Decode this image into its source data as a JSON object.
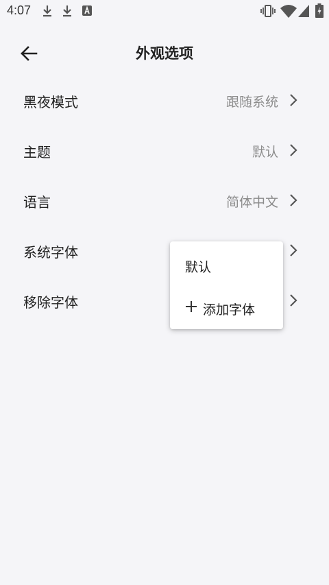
{
  "status_bar": {
    "time": "4:07",
    "icons": [
      "download-icon",
      "download-icon",
      "a-icon",
      "vibrate-icon",
      "wifi-icon",
      "signal-icon",
      "battery-charging-icon"
    ]
  },
  "header": {
    "title": "外观选项",
    "back_icon": "arrow-left-icon"
  },
  "settings": [
    {
      "label": "黑夜模式",
      "value": "跟随系统"
    },
    {
      "label": "主题",
      "value": "默认"
    },
    {
      "label": "语言",
      "value": "简体中文"
    },
    {
      "label": "系统字体",
      "value": ""
    },
    {
      "label": "移除字体",
      "value": ""
    }
  ],
  "popup_menu": {
    "items": [
      {
        "label": "默认"
      },
      {
        "label": "添加字体",
        "icon": "plus-icon"
      }
    ]
  }
}
